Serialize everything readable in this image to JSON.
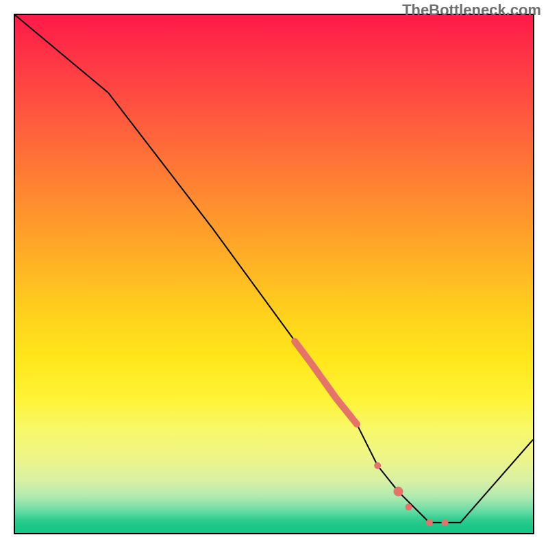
{
  "watermark": "TheBottleneck.com",
  "chart_data": {
    "type": "line",
    "title": "",
    "xlabel": "",
    "ylabel": "",
    "xlim": [
      0,
      100
    ],
    "ylim": [
      0,
      100
    ],
    "grid": false,
    "line": {
      "name": "curve",
      "color": "#000000",
      "width": 2,
      "x": [
        0,
        12,
        18,
        38,
        57,
        66,
        70,
        74,
        80,
        86,
        100
      ],
      "y": [
        100,
        90,
        85,
        59,
        33,
        21,
        13,
        8,
        2,
        2,
        18
      ]
    },
    "highlight": {
      "name": "thick-segment",
      "color": "#e57368",
      "width": 10,
      "x": [
        54,
        57,
        62,
        66
      ],
      "y": [
        37,
        33,
        26,
        21
      ]
    },
    "dots": [
      {
        "x": 70,
        "y": 13,
        "r": 5,
        "color": "#e57368"
      },
      {
        "x": 74,
        "y": 8,
        "r": 7,
        "color": "#e57368"
      },
      {
        "x": 76,
        "y": 5,
        "r": 5,
        "color": "#e57368"
      },
      {
        "x": 80,
        "y": 2,
        "r": 5,
        "color": "#e57368"
      },
      {
        "x": 83,
        "y": 2,
        "r": 5,
        "color": "#e57368"
      }
    ]
  }
}
